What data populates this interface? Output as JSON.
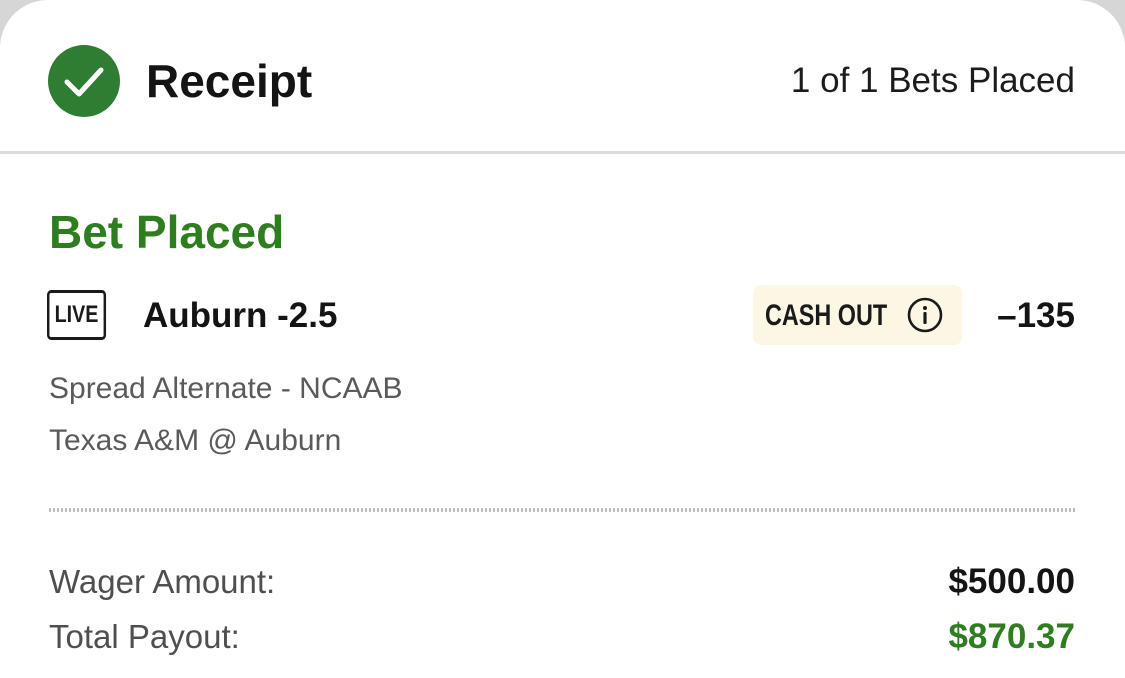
{
  "header": {
    "title": "Receipt",
    "bets_count": "1 of 1 Bets Placed",
    "status_icon": "check-circle-icon"
  },
  "bet": {
    "status": "Bet Placed",
    "live_badge": "LIVE",
    "selection": "Auburn -2.5",
    "cash_out_label": "CASH OUT",
    "cash_out_icon": "info-icon",
    "odds": "–135",
    "market": "Spread Alternate - NCAAB",
    "event": "Texas A&M @ Auburn"
  },
  "summary": {
    "wager_label": "Wager Amount:",
    "wager_value": "$500.00",
    "payout_label": "Total Payout:",
    "payout_value": "$870.37"
  },
  "colors": {
    "accent_green": "#2e7d1f",
    "check_green": "#2e7d32",
    "cash_out_bg": "#fbf7e4"
  }
}
